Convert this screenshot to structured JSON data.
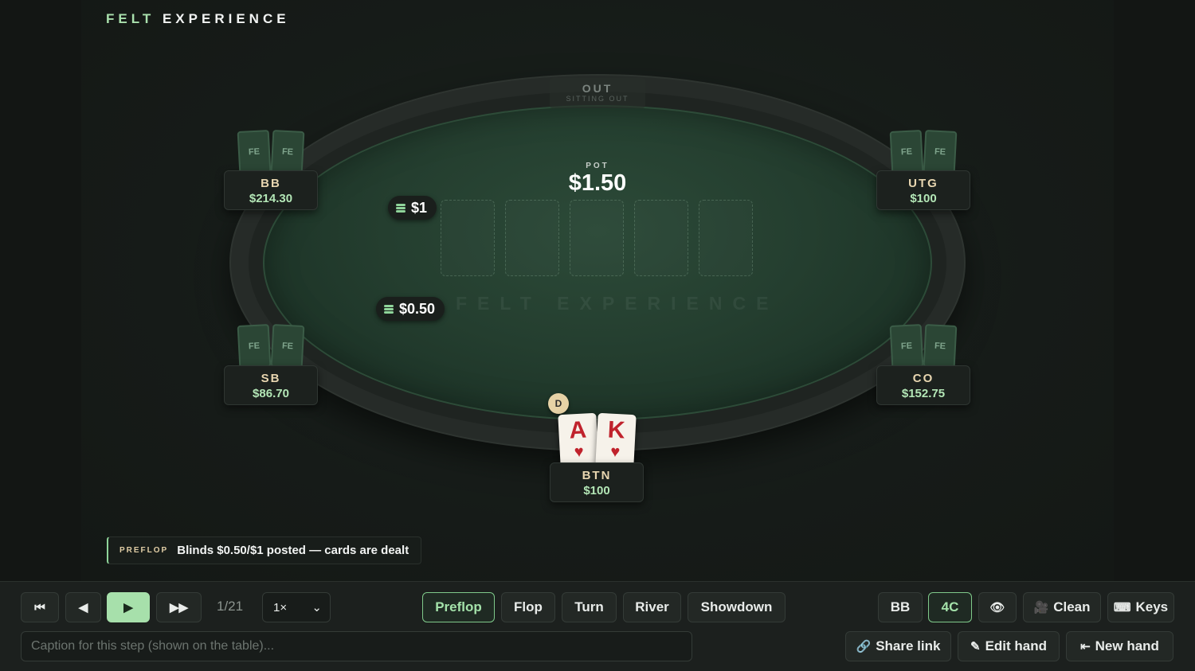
{
  "brand": {
    "part1": "FELT",
    "part2": "EXPERIENCE"
  },
  "table": {
    "watermark": "FELT EXPERIENCE",
    "pot_label": "POT",
    "pot_value": "$1.50",
    "out_seat": {
      "label": "OUT",
      "sublabel": "SITTING OUT"
    }
  },
  "bets": {
    "bb": "$1",
    "sb": "$0.50"
  },
  "card_back_text": "FE",
  "seats": {
    "bb": {
      "pos": "BB",
      "stack": "$214.30"
    },
    "utg": {
      "pos": "UTG",
      "stack": "$100"
    },
    "sb": {
      "pos": "SB",
      "stack": "$86.70"
    },
    "co": {
      "pos": "CO",
      "stack": "$152.75"
    },
    "btn": {
      "pos": "BTN",
      "stack": "$100"
    }
  },
  "dealer_button": "D",
  "hero_cards": [
    {
      "rank": "A",
      "suit": "♥"
    },
    {
      "rank": "K",
      "suit": "♥"
    }
  ],
  "caption": {
    "street": "PREFLOP",
    "text": "Blinds $0.50/$1 posted — cards are dealt"
  },
  "controls": {
    "first_icon": "⏮",
    "prev_icon": "◀",
    "play_icon": "▶",
    "next_icon": "▶▶",
    "step_counter": "1/21",
    "speed_value": "1×",
    "speed_chevron": "⌄",
    "streets": [
      "Preflop",
      "Flop",
      "Turn",
      "River",
      "Showdown"
    ],
    "bb_toggle": "BB",
    "four_color_toggle": "4C",
    "eye_icon": "👁",
    "clean_icon": "🎥",
    "clean_label": "Clean",
    "keys_icon": "⌨",
    "keys_label": "Keys",
    "caption_placeholder": "Caption for this step (shown on the table)...",
    "share_icon": "🔗",
    "share_label": "Share link",
    "edit_icon": "✎",
    "edit_label": "Edit hand",
    "new_icon": "⇤",
    "new_label": "New hand"
  },
  "colors": {
    "accent": "#a7e0ab",
    "felt": "#243e2f",
    "card_red": "#c0222c"
  }
}
